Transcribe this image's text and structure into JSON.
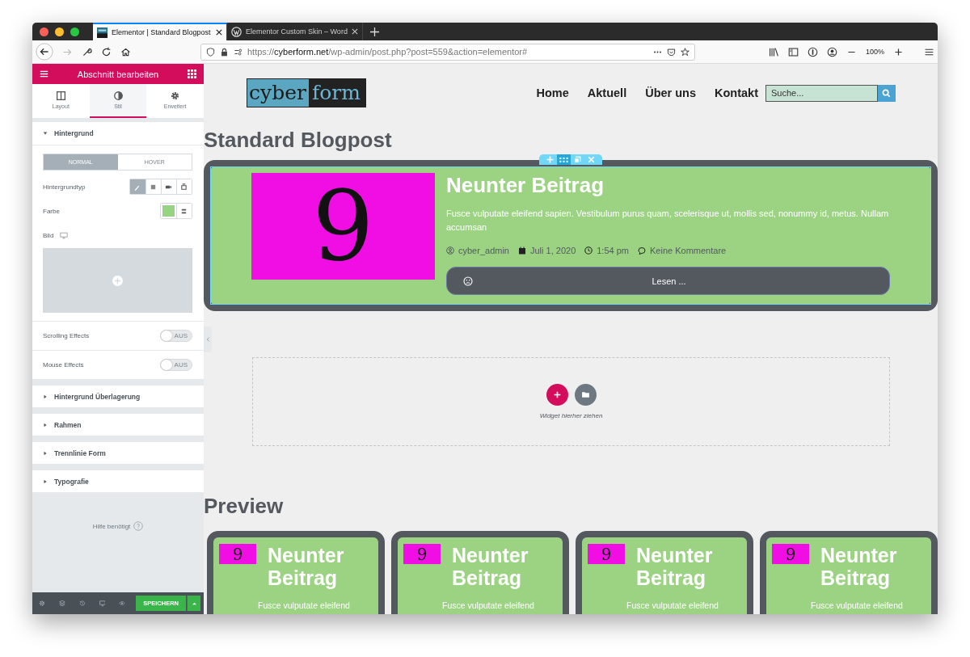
{
  "browser": {
    "tabs": [
      {
        "title": "Elementor | Standard Blogpost",
        "selected": true,
        "kind": "elementor"
      },
      {
        "title": "Elementor Custom Skin – Word",
        "selected": false,
        "kind": "wordpress"
      }
    ],
    "url_scheme": "https://",
    "url_host": "cyberform.net",
    "url_path": "/wp-admin/post.php?post=559&action=elementor#",
    "zoom": "100%"
  },
  "panel": {
    "title": "Abschnitt bearbeiten",
    "tabs": [
      {
        "label": "Layout",
        "selected": false,
        "kind": "layout"
      },
      {
        "label": "Stil",
        "selected": true,
        "kind": "style"
      },
      {
        "label": "Erweitert",
        "selected": false,
        "kind": "advanced"
      }
    ],
    "background": {
      "title": "Hintergrund",
      "expanded": true,
      "states": [
        {
          "label": "NORMAL",
          "selected": true
        },
        {
          "label": "HOVER",
          "selected": false
        }
      ],
      "type_label": "Hintergrundtyp",
      "type_options": [
        {
          "kind": "classic",
          "selected": true
        },
        {
          "kind": "gradient",
          "selected": false
        },
        {
          "kind": "video",
          "selected": false
        },
        {
          "kind": "slideshow",
          "selected": false
        }
      ],
      "color_label": "Farbe",
      "color": "#98d383",
      "image_label": "Bild"
    },
    "toggles": [
      {
        "label": "Scrolling Effects",
        "on": false,
        "state_text": "AUS"
      },
      {
        "label": "Mouse Effects",
        "on": false,
        "state_text": "AUS"
      }
    ],
    "sections": [
      {
        "title": "Hintergrund Überlagerung",
        "expanded": false
      },
      {
        "title": "Rahmen",
        "expanded": false
      },
      {
        "title": "Trennlinie Form",
        "expanded": false
      },
      {
        "title": "Typografie",
        "expanded": false
      }
    ],
    "help": "Hilfe benötigt",
    "save": "SPEICHERN"
  },
  "site": {
    "logo_left": "cyber",
    "logo_right": "form",
    "nav": [
      "Home",
      "Aktuell",
      "Über uns",
      "Kontakt"
    ],
    "search": {
      "placeholder": "Suche..."
    },
    "page_title": "Standard Blogpost",
    "post": {
      "digit": "9",
      "title": "Neunter Beitrag",
      "excerpt": "Fusce vulputate eleifend sapien. Vestibulum purus quam, scelerisque ut, mollis sed, nonummy id, metus. Nullam accumsan",
      "author": "cyber_admin",
      "date": "Juli 1, 2020",
      "time": "1:54 pm",
      "comments": "Keine Kommentare",
      "button": "Lesen ..."
    },
    "drop_zone": "Widget hierher ziehen",
    "preview_title": "Preview",
    "cards": [
      {
        "digit": "9",
        "title": "Neunter Beitrag",
        "excerpt": "Fusce vulputate eleifend"
      },
      {
        "digit": "9",
        "title": "Neunter Beitrag",
        "excerpt": "Fusce vulputate eleifend"
      },
      {
        "digit": "9",
        "title": "Neunter Beitrag",
        "excerpt": "Fusce vulputate eleifend"
      },
      {
        "digit": "9",
        "title": "Neunter Beitrag",
        "excerpt": "Fusce vulputate eleifend"
      }
    ]
  }
}
